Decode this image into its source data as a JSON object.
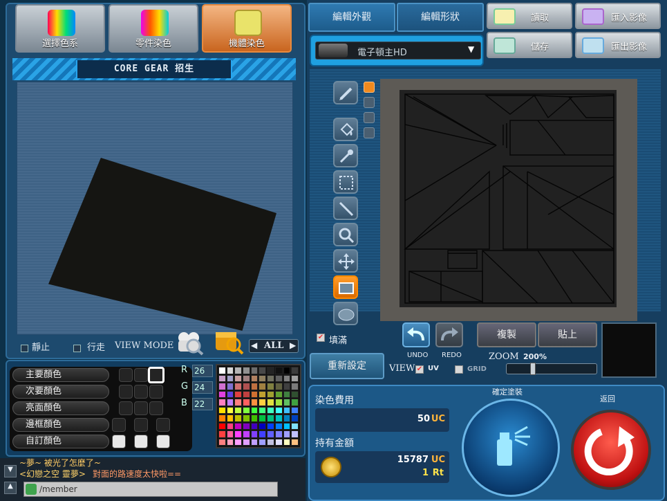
{
  "left_tabs": [
    {
      "label": "選擇色系"
    },
    {
      "label": "零件染色"
    },
    {
      "label": "機體染色"
    }
  ],
  "title": "CORE GEAR 招生",
  "viewbar": {
    "still": "靜止",
    "walk": "行走",
    "view_mode": "VIEW MODE",
    "filter": "ALL"
  },
  "color_rows": [
    {
      "label": "主要顏色"
    },
    {
      "label": "次要顏色"
    },
    {
      "label": "亮面顏色"
    },
    {
      "label": "邊框顏色"
    },
    {
      "label": "自訂顏色"
    }
  ],
  "rgb": {
    "r_label": "R",
    "r": "26",
    "g_label": "G",
    "g": "24",
    "b_label": "B",
    "b": "22"
  },
  "palette_colors": [
    "#ffffff",
    "#d8d8d8",
    "#b4b4b4",
    "#909090",
    "#6c6c6c",
    "#484848",
    "#242424",
    "#111111",
    "#000000",
    "#3c3c3c",
    "#c8a0c8",
    "#a0a0c8",
    "#c8a0a0",
    "#a08080",
    "#b08060",
    "#908060",
    "#707060",
    "#606060",
    "#808080",
    "#a0a0a0",
    "#d070d0",
    "#8070d0",
    "#d07070",
    "#b05050",
    "#c07040",
    "#a08040",
    "#808040",
    "#606040",
    "#404040",
    "#7a7a7a",
    "#e040e0",
    "#6040e0",
    "#e04040",
    "#c04040",
    "#d07030",
    "#c0a030",
    "#a0a030",
    "#60a030",
    "#408040",
    "#305030",
    "#ff80c0",
    "#c080ff",
    "#ff8080",
    "#ff6060",
    "#ff9040",
    "#ffd040",
    "#e0e040",
    "#a0e040",
    "#60c060",
    "#40a040",
    "#ffe000",
    "#ffff40",
    "#c0ff40",
    "#80ff40",
    "#40ff40",
    "#40ff80",
    "#40ffc0",
    "#40ffff",
    "#40c0ff",
    "#4080ff",
    "#ff8000",
    "#ffc000",
    "#c0c000",
    "#80c000",
    "#40c000",
    "#00c040",
    "#00c080",
    "#00c0c0",
    "#0080c0",
    "#0040c0",
    "#ff0000",
    "#ff4080",
    "#c000c0",
    "#8000c0",
    "#4000c0",
    "#0000c0",
    "#0040ff",
    "#0080ff",
    "#00c0ff",
    "#80e0ff",
    "#ff4040",
    "#ff60a0",
    "#ff40ff",
    "#c040ff",
    "#8040ff",
    "#4040ff",
    "#6060ff",
    "#8080ff",
    "#a0a0ff",
    "#c0c0ff",
    "#ff8080",
    "#ffa0c0",
    "#ffa0ff",
    "#e0a0ff",
    "#c0a0ff",
    "#a0a0ff",
    "#c0c0e0",
    "#e0e0ff",
    "#ffffc0",
    "#ffc080"
  ],
  "chat": {
    "line1": "~夢~ 被光了怎麼了~",
    "line2_name": "<幻戀之空 靈夢>",
    "line2_msg": "對面的路速度太快啦==",
    "input_prefix": "/member"
  },
  "right_tabs": [
    {
      "label": "編輯外觀"
    },
    {
      "label": "編輯形狀"
    }
  ],
  "file_buttons": [
    {
      "label": "讀取"
    },
    {
      "label": "匯入影像"
    },
    {
      "label": "儲存"
    },
    {
      "label": "匯出影像"
    }
  ],
  "part_select": {
    "value": "電子頓主HD"
  },
  "fill_label": "填滿",
  "reset_label": "重新設定",
  "undo_label": "UNDO",
  "redo_label": "REDO",
  "copy_label": "複製",
  "paste_label": "貼上",
  "zoom": {
    "label": "ZOOM",
    "value": "200%"
  },
  "view": {
    "label": "VIEW",
    "uv": "UV",
    "grid": "GRID"
  },
  "cost": {
    "label": "染色費用",
    "value": "50",
    "unit": "UC"
  },
  "balance": {
    "label": "持有金額",
    "uc": "15787",
    "uc_unit": "UC",
    "rt": "1",
    "rt_unit": "Rt"
  },
  "confirm_label": "確定塗裝",
  "back_label": "返回"
}
